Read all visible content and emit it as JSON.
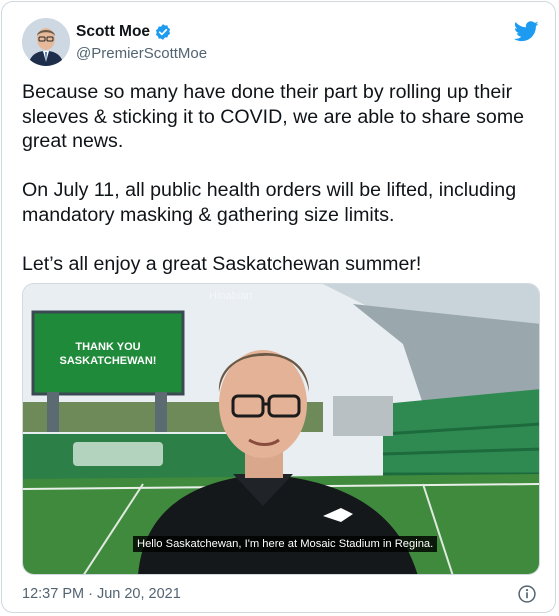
{
  "author": {
    "display_name": "Scott Moe",
    "handle": "@PremierScottMoe",
    "verified_icon": "verified-badge-icon"
  },
  "brand_icon": "twitter-bird-icon",
  "colors": {
    "twitter_blue": "#1d9bf0",
    "secondary_text": "#536471",
    "field_green": "#1f8a3a"
  },
  "tweet": {
    "text": "Because so many have done their part by rolling up their sleeves & sticking it to COVID, we are able to share some great news.\n\nOn July 11, all public health orders will be lifted, including mandatory masking & gathering size limits.\n\nLet’s all enjoy a great Saskatchewan summer!"
  },
  "media": {
    "scoreboard_text": "THANK YOU SASKATCHEWAN!",
    "caption": "Hello Saskatchewan, I'm here at Mosaic Stadium in Regina.",
    "watermark": "Hinabian"
  },
  "meta": {
    "timestamp": "12:37 PM · Jun 20, 2021",
    "info_icon": "info-icon"
  }
}
